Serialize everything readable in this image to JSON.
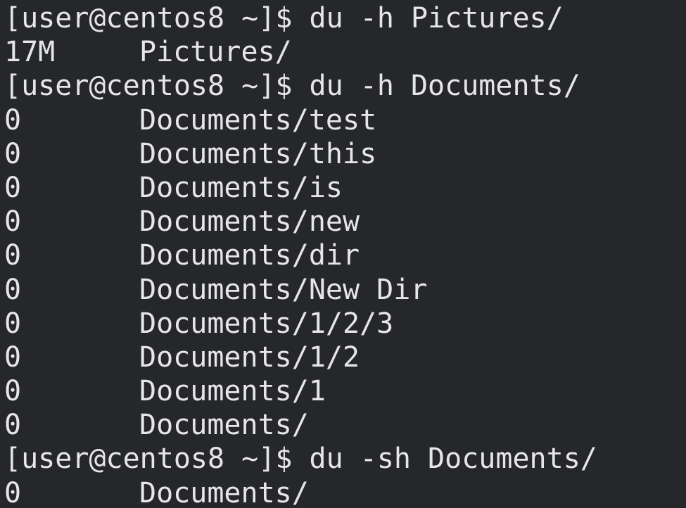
{
  "terminal": {
    "prompt": "[user@centos8 ~]$ ",
    "lines": [
      {
        "kind": "command",
        "text": "du -h Pictures/"
      },
      {
        "kind": "output",
        "size": "17M",
        "path": "Pictures/"
      },
      {
        "kind": "command",
        "text": "du -h Documents/"
      },
      {
        "kind": "output",
        "size": "0",
        "path": "Documents/test"
      },
      {
        "kind": "output",
        "size": "0",
        "path": "Documents/this"
      },
      {
        "kind": "output",
        "size": "0",
        "path": "Documents/is"
      },
      {
        "kind": "output",
        "size": "0",
        "path": "Documents/new"
      },
      {
        "kind": "output",
        "size": "0",
        "path": "Documents/dir"
      },
      {
        "kind": "output",
        "size": "0",
        "path": "Documents/New Dir"
      },
      {
        "kind": "output",
        "size": "0",
        "path": "Documents/1/2/3"
      },
      {
        "kind": "output",
        "size": "0",
        "path": "Documents/1/2"
      },
      {
        "kind": "output",
        "size": "0",
        "path": "Documents/1"
      },
      {
        "kind": "output",
        "size": "0",
        "path": "Documents/"
      },
      {
        "kind": "command",
        "text": "du -sh Documents/"
      },
      {
        "kind": "output",
        "size": "0",
        "path": "Documents/"
      }
    ]
  },
  "colors": {
    "background": "#25272b",
    "foreground": "#e6e6e6"
  }
}
